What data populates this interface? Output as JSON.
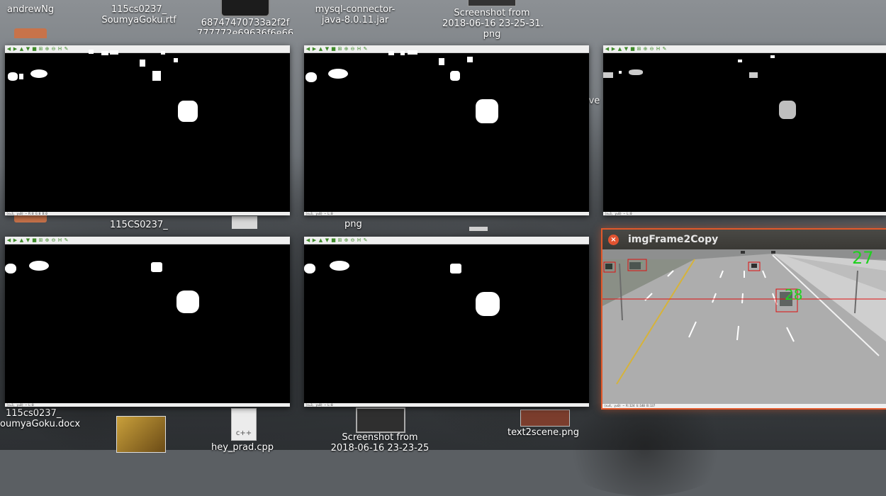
{
  "desktop": {
    "labels": {
      "andrewng": "andrewNg",
      "rtf_1": "115cs0237_",
      "rtf_2": "SoumyaGoku.rtf",
      "hash_1": "68747470733a2f2f",
      "hash_2": "777772e69636f6e66",
      "mysql_1": "mysql-connector-",
      "mysql_2": "java-8.0.11.jar",
      "shot1_1": "Screenshot from",
      "shot1_2": "2018-06-16 23-25-31.",
      "shot1_3": "png",
      "folder": "115CS0237_",
      "png": "png",
      "docx_1": "115cs0237_",
      "docx_2": "oumyaGoku.docx",
      "cpp": "hey_prad.cpp",
      "shot2_1": "Screenshot from",
      "shot2_2": "2018-06-16 23-23-25",
      "text2scene": "text2scene.png",
      "partial_ive": "ive"
    }
  },
  "viewer": {
    "toolbar_icons": [
      "arrow-left",
      "arrow-right",
      "arrow-up",
      "arrow-down",
      "save",
      "zoom-fit",
      "zoom-in",
      "zoom-out",
      "zoom-100",
      "properties"
    ],
    "status_texts": [
      "(x=3, y=0) ~ R:0 G:0 B:0",
      "(x=3, y=0) ~ L:0",
      "(x=3, y=0) ~ L:0",
      "(x=3, y=0) ~ L:0",
      "(x=3, y=0) ~ L:0"
    ]
  },
  "frame_window": {
    "title": "imgFrame2Copy",
    "close_glyph": "×",
    "counter_top": "27",
    "car_label": "28",
    "status": "(x=4, y=0) ~ R:124 G:140 B:137",
    "box_color": "#e01010",
    "counter_color": "#1fd11f"
  }
}
